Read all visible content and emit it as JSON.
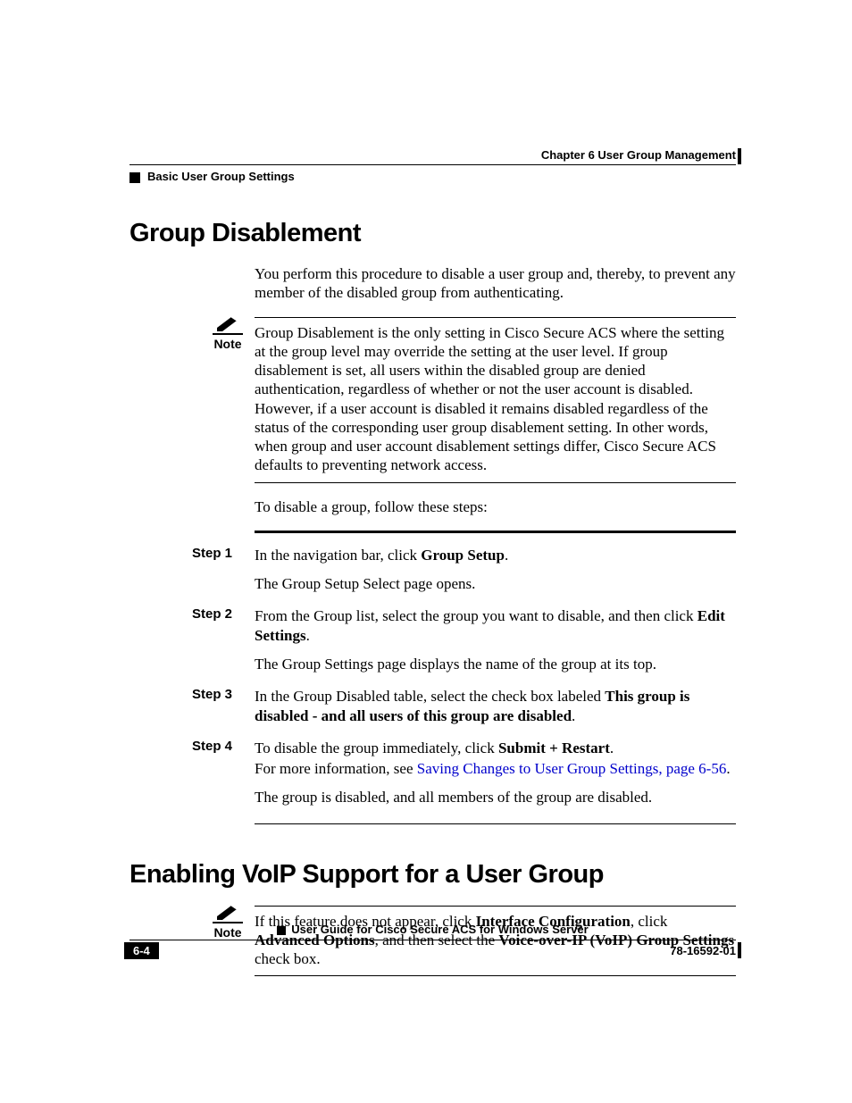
{
  "header": {
    "chapter": "Chapter 6      User Group Management",
    "section": "Basic User Group Settings"
  },
  "section1": {
    "title": "Group Disablement",
    "intro": "You perform this procedure to disable a user group and, thereby, to prevent any member of the disabled group from authenticating.",
    "note_label": "Note",
    "note": "Group Disablement is the only setting in Cisco Secure ACS where the setting at the group level may override the setting at the user level. If group disablement is set, all users within the disabled group are denied authentication, regardless of whether or not the user account is disabled. However, if a user account is disabled it remains disabled regardless of the status of the corresponding user group disablement setting. In other words, when group and user account disablement settings differ, Cisco Secure ACS defaults to preventing network access.",
    "lead": "To disable a group, follow these steps:",
    "steps": {
      "s1_label": "Step 1",
      "s1_a_pre": "In the navigation bar, click ",
      "s1_a_bold": "Group Setup",
      "s1_a_post": ".",
      "s1_b": "The Group Setup Select page opens.",
      "s2_label": "Step 2",
      "s2_a_pre": "From the Group list, select the group you want to disable, and then click ",
      "s2_a_bold": "Edit Settings",
      "s2_a_post": ".",
      "s2_b": "The Group Settings page displays the name of the group at its top.",
      "s3_label": "Step 3",
      "s3_pre": "In the Group Disabled table, select the check box labeled ",
      "s3_bold": "This group is disabled - and all users of this group are disabled",
      "s3_post": ".",
      "s4_label": "Step 4",
      "s4_a_pre": "To disable the group immediately, click ",
      "s4_a_bold": "Submit + Restart",
      "s4_a_post": ".",
      "s4_b_pre": "For more information, see ",
      "s4_b_link": "Saving Changes to User Group Settings, page 6-56",
      "s4_b_post": ".",
      "s4_c": "The group is disabled, and all members of the group are disabled."
    }
  },
  "section2": {
    "title": "Enabling VoIP Support for a User Group",
    "note_label": "Note",
    "note_pre": "If this feature does not appear, click ",
    "note_b1": "Interface Configuration",
    "note_mid1": ", click ",
    "note_b2": "Advanced Options",
    "note_mid2": ", and then select the ",
    "note_b3": "Voice-over-IP (VoIP) Group Settings",
    "note_post": " check box."
  },
  "footer": {
    "title": "User Guide for Cisco Secure ACS for Windows Server",
    "page": "6-4",
    "docnum": "78-16592-01"
  }
}
